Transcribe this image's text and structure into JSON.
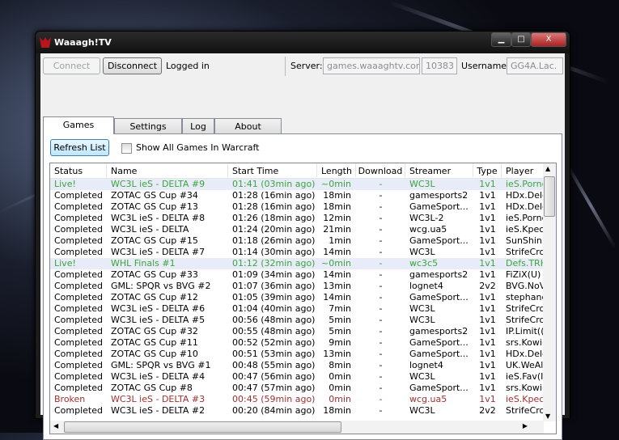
{
  "window": {
    "title": "Waaagh!TV",
    "minimize": "▁",
    "maximize": "□",
    "close": "X"
  },
  "toolbar": {
    "connect": "Connect",
    "disconnect": "Disconnect",
    "status": "Logged in",
    "server_label": "Server:",
    "server": "games.waaaghtv.com",
    "port": "10383",
    "username_label": "Username:",
    "username": "GG4A.Lac."
  },
  "tabs": [
    {
      "label": "Games",
      "active": true
    },
    {
      "label": "Settings"
    },
    {
      "label": "Log"
    },
    {
      "label": "About"
    }
  ],
  "games": {
    "refresh": "Refresh List",
    "show_all": "Show All Games In Warcraft",
    "show_all_checked": false,
    "columns": [
      "Status",
      "Name",
      "Start Time",
      "Length",
      "Download",
      "Streamer",
      "Type",
      "Player"
    ],
    "rows": [
      [
        "Live!",
        "WC3L ieS - DELTA #9",
        "01:41 (03min ago)",
        "~0min",
        "-",
        "WC3L",
        "1v1",
        "ieS.Pornc"
      ],
      [
        "Completed",
        "ZOTAC GS Cup #34",
        "01:28 (16min ago)",
        "18min",
        "-",
        "gamesports2",
        "1v1",
        "HDx.Delc"
      ],
      [
        "Completed",
        "ZOTAC GS Cup #13",
        "01:28 (16min ago)",
        "18min",
        "-",
        "GameSport...",
        "1v1",
        "HDx.Delc"
      ],
      [
        "Completed",
        "WC3L ieS - DELTA #8",
        "01:26 (18min ago)",
        "12min",
        "-",
        "WC3L-2",
        "1v1",
        "ieS.Pornc"
      ],
      [
        "Completed",
        "WC3L ieS - DELTA",
        "01:24 (20min ago)",
        "21min",
        "-",
        "wcg.ua5",
        "1v1",
        "ieS.Kpecl"
      ],
      [
        "Completed",
        "ZOTAC GS Cup #15",
        "01:18 (26min ago)",
        "1min",
        "-",
        "GameSport...",
        "1v1",
        "SunShinE"
      ],
      [
        "Completed",
        "WC3L ieS - DELTA #7",
        "01:14 (30min ago)",
        "14min",
        "-",
        "WC3L",
        "1v1",
        "StrifeCro"
      ],
      [
        "Live!",
        "WHL Finals #1",
        "01:12 (32min ago)",
        "~0min",
        "-",
        "wc3c5",
        "1v1",
        "Defs.TRH"
      ],
      [
        "Completed",
        "ZOTAC GS Cup #33",
        "01:09 (34min ago)",
        "14min",
        "-",
        "gamesports2",
        "1v1",
        "FiZiX(U) -"
      ],
      [
        "Completed",
        "GML: SPQR vs BVG #2",
        "01:07 (36min ago)",
        "13min",
        "-",
        "lognet4",
        "2v2",
        "BVG.NoV"
      ],
      [
        "Completed",
        "ZOTAC GS Cup #12",
        "01:05 (39min ago)",
        "14min",
        "-",
        "GameSport...",
        "1v1",
        "stephanc"
      ],
      [
        "Completed",
        "WC3L ieS - DELTA #6",
        "01:04 (40min ago)",
        "7min",
        "-",
        "WC3L",
        "1v1",
        "StrifeCro"
      ],
      [
        "Completed",
        "WC3L ieS - DELTA #5",
        "00:56 (48min ago)",
        "5min",
        "-",
        "WC3L",
        "1v1",
        "StrifeCro"
      ],
      [
        "Completed",
        "ZOTAC GS Cup #32",
        "00:55 (48min ago)",
        "5min",
        "-",
        "gamesports2",
        "1v1",
        "IP.Limit(("
      ],
      [
        "Completed",
        "ZOTAC GS Cup #11",
        "00:52 (52min ago)",
        "9min",
        "-",
        "GameSport...",
        "1v1",
        "srs.Kowi("
      ],
      [
        "Completed",
        "ZOTAC GS Cup #10",
        "00:51 (53min ago)",
        "13min",
        "-",
        "GameSport...",
        "1v1",
        "HDx.Delc"
      ],
      [
        "Completed",
        "GML: SPQR vs BVG #1",
        "00:48 (55min ago)",
        "8min",
        "-",
        "lognet4",
        "1v1",
        "UK.WeAl"
      ],
      [
        "Completed",
        "WC3L ieS - DELTA #4",
        "00:47 (56min ago)",
        "0min",
        "-",
        "WC3L",
        "1v1",
        "ieS.Fav(I"
      ],
      [
        "Completed",
        "ZOTAC GS Cup #8",
        "00:47 (57min ago)",
        "0min",
        "-",
        "GameSport...",
        "1v1",
        "srs.Kowi("
      ],
      [
        "Broken",
        "WC3L ieS - DELTA #3",
        "00:45 (59min ago)",
        "0min",
        "-",
        "wcg.ua5",
        "1v1",
        "ieS.Kpecl"
      ],
      [
        "Completed",
        "WC3L ieS - DELTA #2",
        "00:20 (84min ago)",
        "18min",
        "-",
        "WC3L",
        "2v2",
        "StrifeCro"
      ]
    ]
  },
  "colors": {
    "live": "#3aa53a",
    "broken": "#a03030",
    "live_row_bg": "#e8ecf8"
  }
}
